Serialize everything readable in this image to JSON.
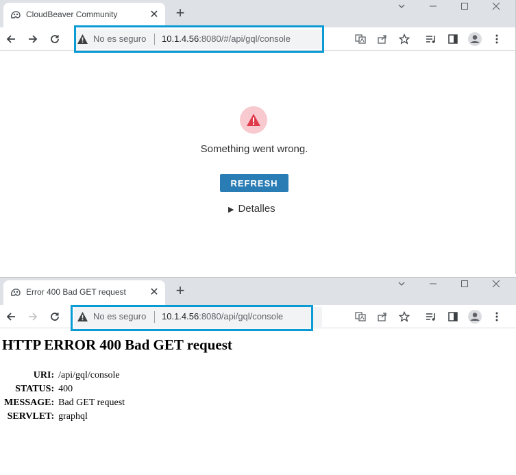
{
  "window1": {
    "tab_title": "CloudBeaver Community",
    "tab_close": "✕",
    "new_tab": "+",
    "security_label": "No es seguro",
    "url_host": "10.1.4.56",
    "url_path": ":8080/#/api/gql/console",
    "error_message": "Something went wrong.",
    "refresh_label": "REFRESH",
    "details_label": "Detalles",
    "details_marker": "▶",
    "error_icon": "warning-triangle-icon"
  },
  "window2": {
    "tab_title": "Error 400 Bad GET request",
    "tab_close": "✕",
    "new_tab": "+",
    "security_label": "No es seguro",
    "url_host": "10.1.4.56",
    "url_path": ":8080/api/gql/console",
    "heading": "HTTP ERROR 400 Bad GET request",
    "rows": [
      {
        "label": "URI:",
        "value": "/api/gql/console"
      },
      {
        "label": "STATUS:",
        "value": "400"
      },
      {
        "label": "MESSAGE:",
        "value": "Bad GET request"
      },
      {
        "label": "SERVLET:",
        "value": "graphql"
      }
    ]
  },
  "colors": {
    "tab_strip": "#dee1e6",
    "omnibox": "#f1f3f4",
    "highlight_box": "#0a9ad4",
    "refresh_button": "#2a7cb5",
    "error_icon_bg": "#f8c9ce",
    "error_icon": "#e0394a"
  }
}
